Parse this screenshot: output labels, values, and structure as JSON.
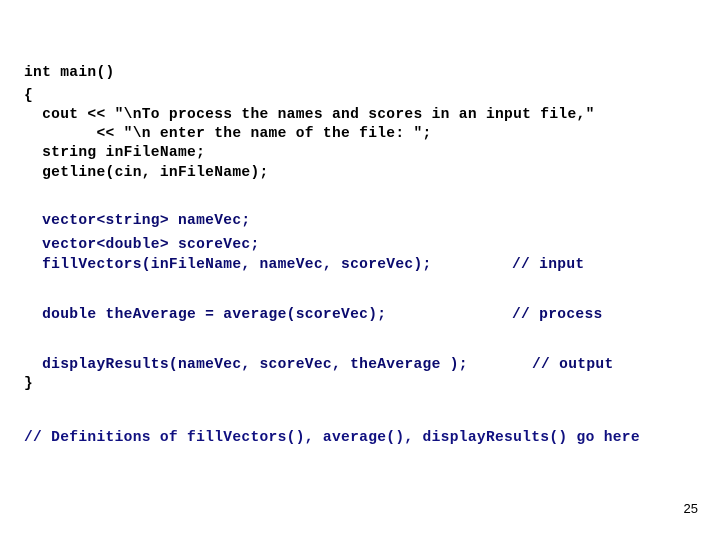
{
  "slide": {
    "code_lines": [
      "int main()",
      "{",
      "  cout << \"\\nTo process the names and scores in an input file,\"",
      "        << \"\\n enter the name of the file: \";",
      "  string inFileName;",
      "  getline(cin, inFileName);",
      "  vector<string> nameVec;",
      "  vector<double> scoreVec;",
      "  fillVectors(inFileName, nameVec, scoreVec);",
      "  double theAverage = average(scoreVec);",
      "  displayResults(nameVec, scoreVec, theAverage );",
      "}",
      "// Definitions of fillVectors(), average(), displayResults() go here"
    ],
    "comments": {
      "input": "// input",
      "process": "// process",
      "output": "// output"
    },
    "page_number": "25",
    "colors": {
      "code_black": "#000000",
      "code_navy": "#0a0a6e"
    }
  }
}
